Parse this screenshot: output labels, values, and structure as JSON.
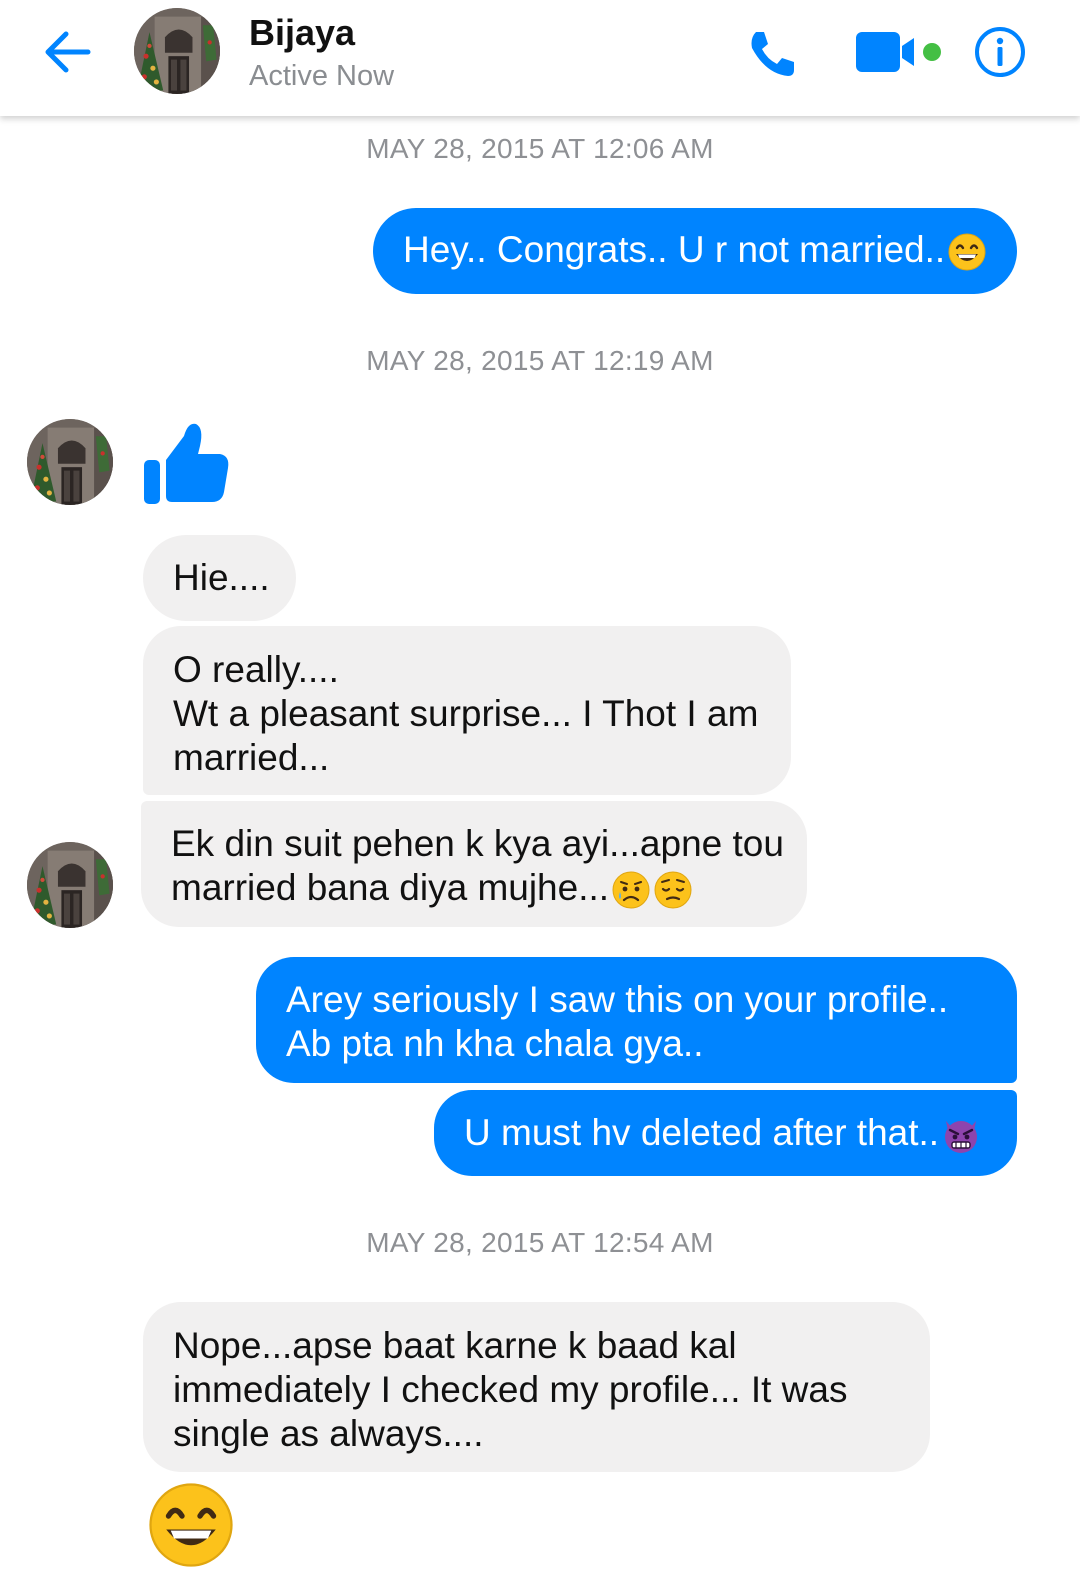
{
  "header": {
    "contact_name": "Bijaya",
    "status": "Active Now"
  },
  "icons": {
    "back": "arrow-left-icon",
    "call": "phone-icon",
    "video": "video-camera-icon",
    "info": "info-icon",
    "like": "thumbs-up-icon"
  },
  "colors": {
    "accent": "#0084ff",
    "incoming_bubble": "#f1f0f0",
    "online_dot": "#44bf44"
  },
  "conversation": {
    "timestamps": [
      "MAY 28, 2015 AT 12:06 AM",
      "MAY 28, 2015 AT 12:19 AM",
      "MAY 28, 2015 AT 12:54 AM"
    ],
    "messages": [
      {
        "sender": "me",
        "text": "Hey.. Congrats.. U r not married..",
        "emoji": "grinning-face"
      },
      {
        "sender": "Bijaya",
        "type": "like",
        "emoji": "thumbs-up"
      },
      {
        "sender": "Bijaya",
        "text": "Hie...."
      },
      {
        "sender": "Bijaya",
        "lines": [
          "O really....",
          "Wt a pleasant surprise... I Thot I am",
          "married..."
        ]
      },
      {
        "sender": "Bijaya",
        "lines": [
          "Ek din suit pehen k kya ayi...apne tou",
          "married bana diya mujhe..."
        ],
        "emojis": [
          "sad-sweat-face",
          "pensive-face"
        ]
      },
      {
        "sender": "me",
        "lines": [
          "Arey seriously I saw this on your profile..",
          "Ab pta nh kha chala gya.."
        ]
      },
      {
        "sender": "me",
        "text": "U must hv deleted after that..",
        "emoji": "angry-devil-face"
      },
      {
        "sender": "Bijaya",
        "lines": [
          "Nope...apse baat karne k baad kal",
          "immediately I checked my profile... It was",
          "single as always...."
        ]
      },
      {
        "sender": "Bijaya",
        "type": "emoji",
        "emoji": "grinning-face-big"
      }
    ]
  }
}
